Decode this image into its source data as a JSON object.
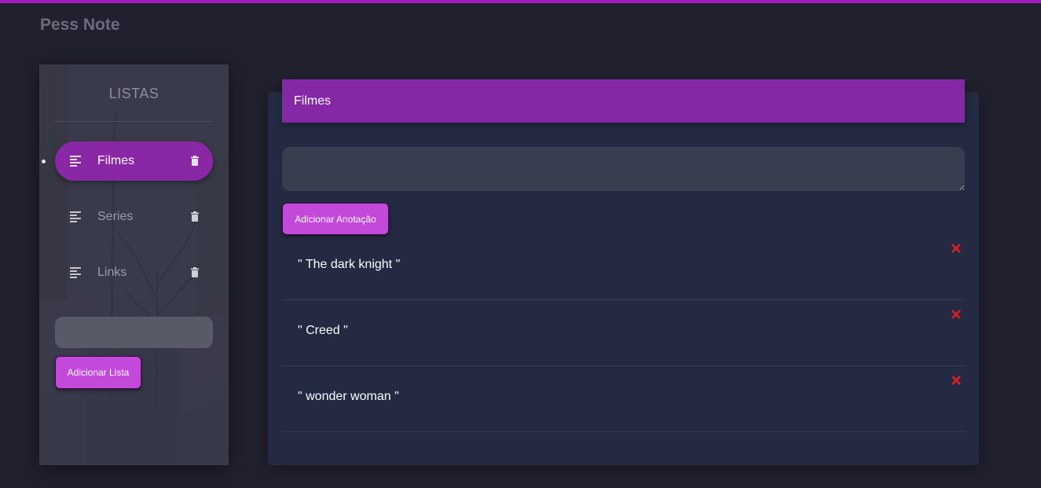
{
  "app": {
    "title": "Pess Note"
  },
  "sidebar": {
    "heading": "LISTAS",
    "items": [
      {
        "label": "Filmes",
        "active": true
      },
      {
        "label": "Series",
        "active": false
      },
      {
        "label": "Links",
        "active": false
      }
    ],
    "input": {
      "value": "",
      "placeholder": ""
    },
    "add_button_label": "Adicionar Lista"
  },
  "main": {
    "title": "Filmes",
    "textarea": {
      "value": "",
      "placeholder": ""
    },
    "add_button_label": "Adicionar Anotação",
    "notes": [
      {
        "text": "\" The dark knight \""
      },
      {
        "text": "\" Creed \""
      },
      {
        "text": "\" wonder woman \""
      }
    ]
  },
  "colors": {
    "background": "#21202e",
    "accent": "#a61bc4",
    "active_item": "#8a27a5",
    "button": "#c249d9",
    "header": "#8428a6",
    "card": "#232a42",
    "delete_icon": "#e11f1f"
  },
  "icons": {
    "list_item_icon": "lines-left-align-icon",
    "list_delete_icon": "trash-icon",
    "note_delete_icon": "close-x-icon"
  }
}
